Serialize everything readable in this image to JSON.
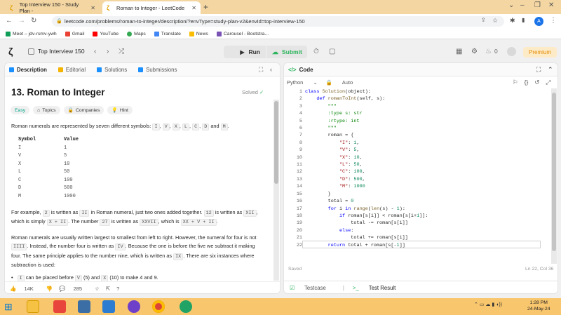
{
  "browser": {
    "tabs": [
      {
        "label": "Top Interview 150 - Study Plan -"
      },
      {
        "label": "Roman to Integer - LeetCode"
      }
    ],
    "new_tab": "+",
    "url": "leetcode.com/problems/roman-to-integer/description/?envType=study-plan-v2&envId=top-interview-150",
    "bookmarks": [
      "Meet – jdv-rsmv-ywh",
      "Gmail",
      "YouTube",
      "Maps",
      "Translate",
      "News",
      "Carousel - Bootstra..."
    ],
    "profile_initial": "A"
  },
  "header": {
    "problem_list": "Top Interview 150",
    "run": "Run",
    "submit": "Submit",
    "streak": "0",
    "premium": "Premium"
  },
  "left_tabs": [
    "Description",
    "Editorial",
    "Solutions",
    "Submissions"
  ],
  "problem": {
    "title": "13. Roman to Integer",
    "status": "Solved",
    "tags": [
      "Easy",
      "Topics",
      "Companies",
      "Hint"
    ],
    "intro_pre": "Roman numerals are represented by seven different symbols:",
    "intro_symbols": [
      "I",
      "V",
      "X",
      "L",
      "C",
      "D",
      "M"
    ],
    "intro_and": "and",
    "table_headers": [
      "Symbol",
      "Value"
    ],
    "table_rows": [
      [
        "I",
        "1"
      ],
      [
        "V",
        "5"
      ],
      [
        "X",
        "10"
      ],
      [
        "L",
        "50"
      ],
      [
        "C",
        "100"
      ],
      [
        "D",
        "500"
      ],
      [
        "M",
        "1000"
      ]
    ],
    "example_p1": "For example,",
    "example_c1": "2",
    "example_p2": "is written as",
    "example_c2": "II",
    "example_p3": "in Roman numeral, just two ones added together.",
    "example_c3": "12",
    "example_p4": "is written as",
    "example_c4": "XII",
    "example_p5": ", which is simply",
    "example_c5": "X + II",
    "example_p6": ". The number",
    "example_c6": "27",
    "example_p7": "is written as",
    "example_c7": "XXVII",
    "example_p8": ", which is",
    "example_c8": "XX + V + II",
    "order_p1": "Roman numerals are usually written largest to smallest from left to right. However, the numeral for four is not",
    "order_c1": "IIII",
    "order_p2": ". Instead, the number four is written as",
    "order_c2": "IV",
    "order_p3": ". Because the one is before the five we subtract it making four. The same principle applies to the number nine, which is written as",
    "order_c3": "IX",
    "order_p4": ". There are six instances where subtraction is used:",
    "bullet_p1": "I",
    "bullet_p2": "can be placed before",
    "bullet_p3": "V",
    "bullet_p4": "(5) and",
    "bullet_p5": "X",
    "bullet_p6": "(10) to make 4 and 9.",
    "likes": "14K",
    "comments": "285"
  },
  "editor": {
    "panel_title": "Code",
    "language": "Python",
    "mode": "Auto",
    "saved": "Saved",
    "cursor": "Ln 22, Col 36",
    "testcase": "Testcase",
    "test_result": "Test Result"
  },
  "taskbar": {
    "time": "1:28 PM",
    "date": "24-May-24"
  }
}
